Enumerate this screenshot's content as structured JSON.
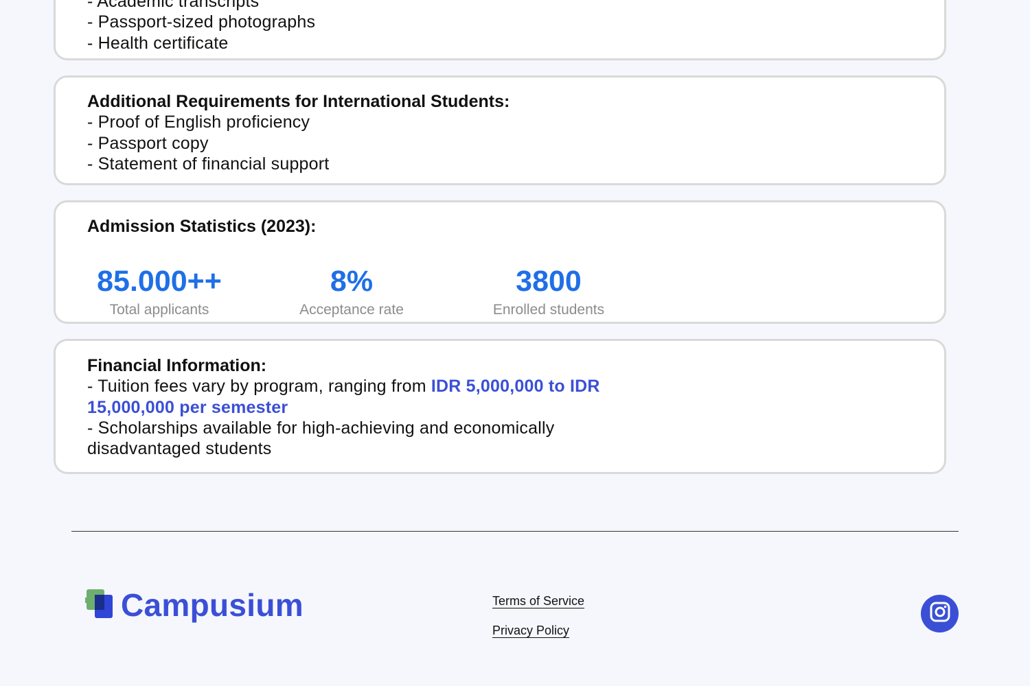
{
  "documents_card": {
    "partial_item": "- Academic transcripts",
    "items": [
      "- Passport-sized photographs",
      "- Health certificate"
    ]
  },
  "international_card": {
    "heading": "Additional Requirements for International Students:",
    "items": [
      "- Proof of English proficiency",
      "- Passport copy",
      "- Statement of financial support"
    ]
  },
  "stats_card": {
    "heading": "Admission Statistics (2023):",
    "stats": [
      {
        "value": "85.000++",
        "label": "Total applicants"
      },
      {
        "value": "8%",
        "label": "Acceptance rate"
      },
      {
        "value": "3800",
        "label": "Enrolled students"
      }
    ]
  },
  "financial_card": {
    "heading": "Financial Information:",
    "tuition_prefix": "- Tuition fees vary by program, ranging from ",
    "tuition_highlight": "IDR 5,000,000 to IDR 15,000,000 per semester",
    "scholarship": "- Scholarships available for high-achieving and economically disadvantaged students"
  },
  "footer": {
    "brand": "Campusium",
    "links": [
      "Terms of Service",
      "Privacy Policy"
    ],
    "social_icon": "instagram-icon"
  },
  "colors": {
    "accent_blue": "#3b4fd6",
    "stat_blue": "#1f6fe6",
    "muted_gray": "#8c8c8c",
    "card_border": "#d9d9d9",
    "page_background": "#f5f7fc"
  }
}
